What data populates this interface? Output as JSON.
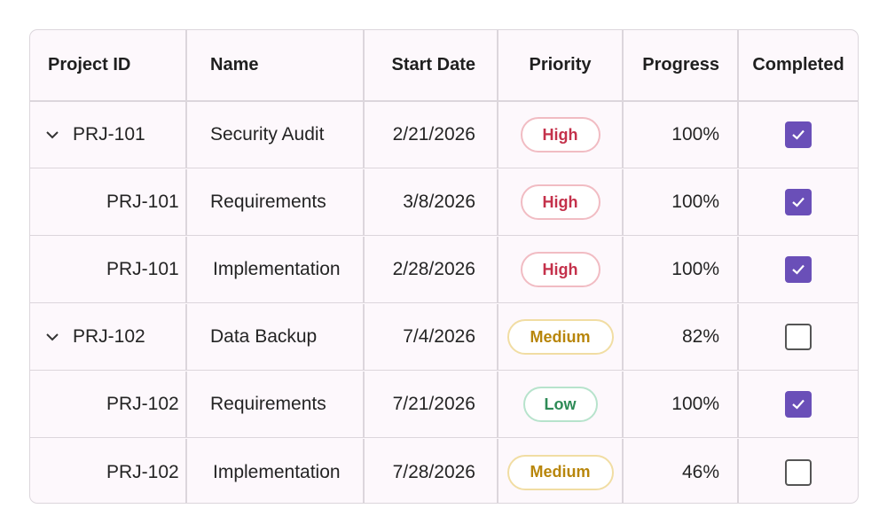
{
  "columns": [
    "Project ID",
    "Name",
    "Start Date",
    "Priority",
    "Progress",
    "Completed"
  ],
  "colors": {
    "accent": "#6a4fb8",
    "high": "#c4314b",
    "medium": "#b8860b",
    "low": "#2e8b57"
  },
  "rows": [
    {
      "level": "parent",
      "expanded": true,
      "project_id": "PRJ-101",
      "name": "Security Audit",
      "start_date": "2/21/2026",
      "priority": "High",
      "progress": "100%",
      "completed": true
    },
    {
      "level": "child",
      "project_id": "PRJ-101",
      "name": "Requirements",
      "start_date": "3/8/2026",
      "priority": "High",
      "progress": "100%",
      "completed": true
    },
    {
      "level": "child",
      "project_id": "PRJ-101",
      "name": "Implementation",
      "start_date": "2/28/2026",
      "priority": "High",
      "progress": "100%",
      "completed": true
    },
    {
      "level": "parent",
      "expanded": true,
      "project_id": "PRJ-102",
      "name": "Data Backup",
      "start_date": "7/4/2026",
      "priority": "Medium",
      "progress": "82%",
      "completed": false
    },
    {
      "level": "child",
      "project_id": "PRJ-102",
      "name": "Requirements",
      "start_date": "7/21/2026",
      "priority": "Low",
      "progress": "100%",
      "completed": true
    },
    {
      "level": "child",
      "project_id": "PRJ-102",
      "name": "Implementation",
      "start_date": "7/28/2026",
      "priority": "Medium",
      "progress": "46%",
      "completed": false
    }
  ]
}
